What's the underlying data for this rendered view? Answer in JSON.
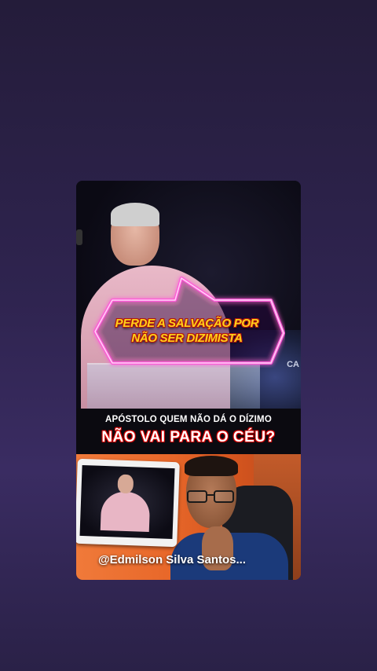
{
  "overlay": {
    "bubble_line1": "PERDE A SALVAÇÃO POR",
    "bubble_line2": "NÃO SER DIZIMISTA",
    "corner_text": "CA"
  },
  "caption": {
    "line1": "APÓSTOLO QUEM NÃO DÁ O DÍZIMO",
    "line2": "NÃO VAI PARA O CÉU?"
  },
  "reaction": {
    "watermark": "@Edmilson Silva Santos..."
  },
  "colors": {
    "background_top": "#241c3a",
    "background_bottom": "#3a2c62",
    "neon_pink": "#ff5ad8",
    "bubble_text": "#ffd21a",
    "bubble_outline": "#b2150f",
    "caption_outline": "#d10000"
  }
}
